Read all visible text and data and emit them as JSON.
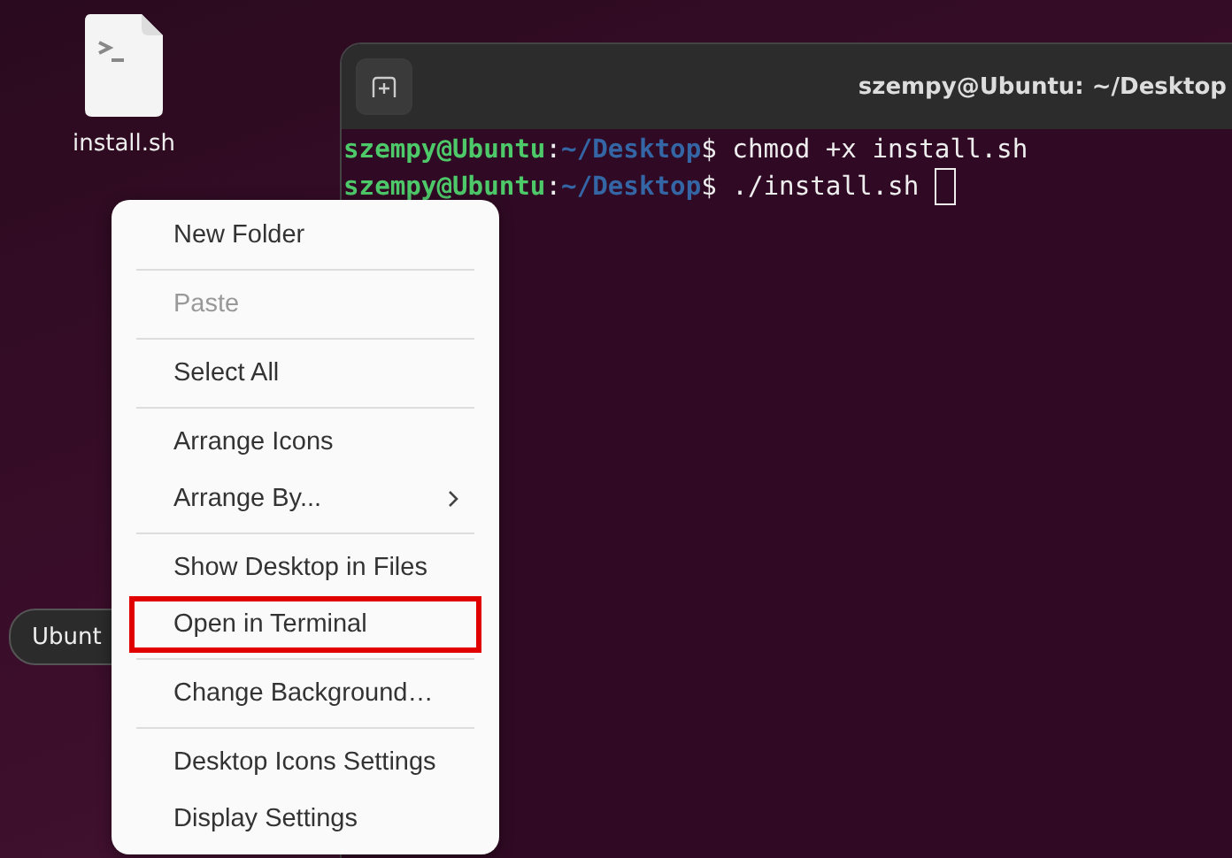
{
  "desktop_icons": [
    {
      "label": "install.sh"
    }
  ],
  "dock_label": {
    "text": "Ubunt"
  },
  "terminal": {
    "title": "szempy@Ubuntu: ~/Desktop",
    "lines": [
      {
        "user": "szempy@Ubuntu",
        "sep": ":",
        "path": "~/Desktop",
        "command": "$ chmod +x install.sh",
        "cursor": false
      },
      {
        "user": "szempy@Ubuntu",
        "sep": ":",
        "path": "~/Desktop",
        "command": "$ ./install.sh",
        "cursor": true
      }
    ]
  },
  "context_menu": {
    "sections": [
      [
        {
          "label": "New Folder",
          "disabled": false,
          "submenu": false,
          "annotated": false
        }
      ],
      [
        {
          "label": "Paste",
          "disabled": true,
          "submenu": false,
          "annotated": false
        }
      ],
      [
        {
          "label": "Select All",
          "disabled": false,
          "submenu": false,
          "annotated": false
        }
      ],
      [
        {
          "label": "Arrange Icons",
          "disabled": false,
          "submenu": false,
          "annotated": false
        },
        {
          "label": "Arrange By...",
          "disabled": false,
          "submenu": true,
          "annotated": false
        }
      ],
      [
        {
          "label": "Show Desktop in Files",
          "disabled": false,
          "submenu": false,
          "annotated": false
        },
        {
          "label": "Open in Terminal",
          "disabled": false,
          "submenu": false,
          "annotated": true
        }
      ],
      [
        {
          "label": "Change Background…",
          "disabled": false,
          "submenu": false,
          "annotated": false
        }
      ],
      [
        {
          "label": "Desktop Icons Settings",
          "disabled": false,
          "submenu": false,
          "annotated": false
        },
        {
          "label": "Display Settings",
          "disabled": false,
          "submenu": false,
          "annotated": false
        }
      ]
    ]
  }
}
